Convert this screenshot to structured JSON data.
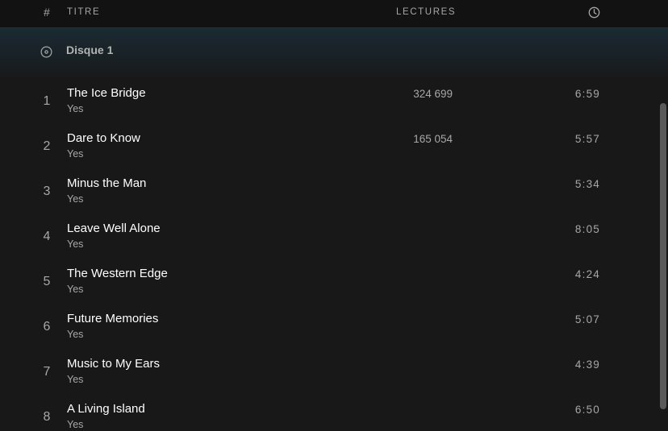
{
  "header": {
    "number_label": "#",
    "title_label": "TITRE",
    "plays_label": "LECTURES",
    "duration_icon": "clock-icon"
  },
  "disc": {
    "icon": "disc-icon",
    "label": "Disque 1"
  },
  "tracks": [
    {
      "number": "1",
      "title": "The Ice Bridge",
      "artist": "Yes",
      "plays": "324 699",
      "duration": "6:59"
    },
    {
      "number": "2",
      "title": "Dare to Know",
      "artist": "Yes",
      "plays": "165 054",
      "duration": "5:57"
    },
    {
      "number": "3",
      "title": "Minus the Man",
      "artist": "Yes",
      "plays": "",
      "duration": "5:34"
    },
    {
      "number": "4",
      "title": "Leave Well Alone",
      "artist": "Yes",
      "plays": "",
      "duration": "8:05"
    },
    {
      "number": "5",
      "title": "The Western Edge",
      "artist": "Yes",
      "plays": "",
      "duration": "4:24"
    },
    {
      "number": "6",
      "title": "Future Memories",
      "artist": "Yes",
      "plays": "",
      "duration": "5:07"
    },
    {
      "number": "7",
      "title": "Music to My Ears",
      "artist": "Yes",
      "plays": "",
      "duration": "4:39"
    },
    {
      "number": "8",
      "title": "A Living Island",
      "artist": "Yes",
      "plays": "",
      "duration": "6:50"
    }
  ],
  "colors": {
    "background": "#181818",
    "header_background": "#121212",
    "text_primary": "#ffffff",
    "text_secondary": "#a7a7a7",
    "disc_gradient_top": "#1a2b33",
    "scrollbar": "#5a5a5a"
  }
}
